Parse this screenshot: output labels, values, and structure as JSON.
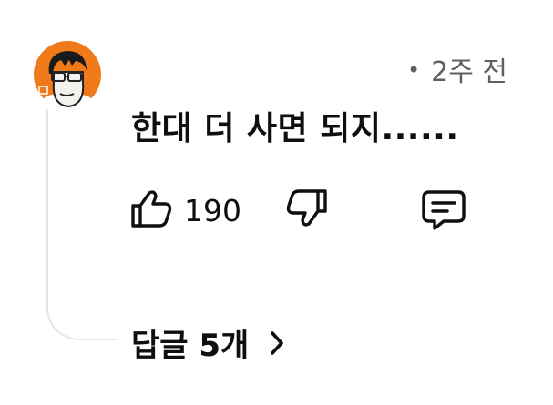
{
  "comment": {
    "timestamp_prefix": "•",
    "timestamp": "2주 전",
    "text": "한대 더 사면 되지......",
    "author_avatar": "cartoon-man-with-glasses-orange-background"
  },
  "actions": {
    "like_count": "190",
    "like_icon": "thumbs-up-icon",
    "dislike_icon": "thumbs-down-icon",
    "reply_icon": "comment-icon"
  },
  "replies": {
    "label": "답글 5개",
    "icon": "chevron-right-icon"
  },
  "colors": {
    "text": "#0f0f0f",
    "secondary_text": "#606060",
    "thread_line": "#e5e5e5",
    "avatar_background": "#f07a1a"
  }
}
